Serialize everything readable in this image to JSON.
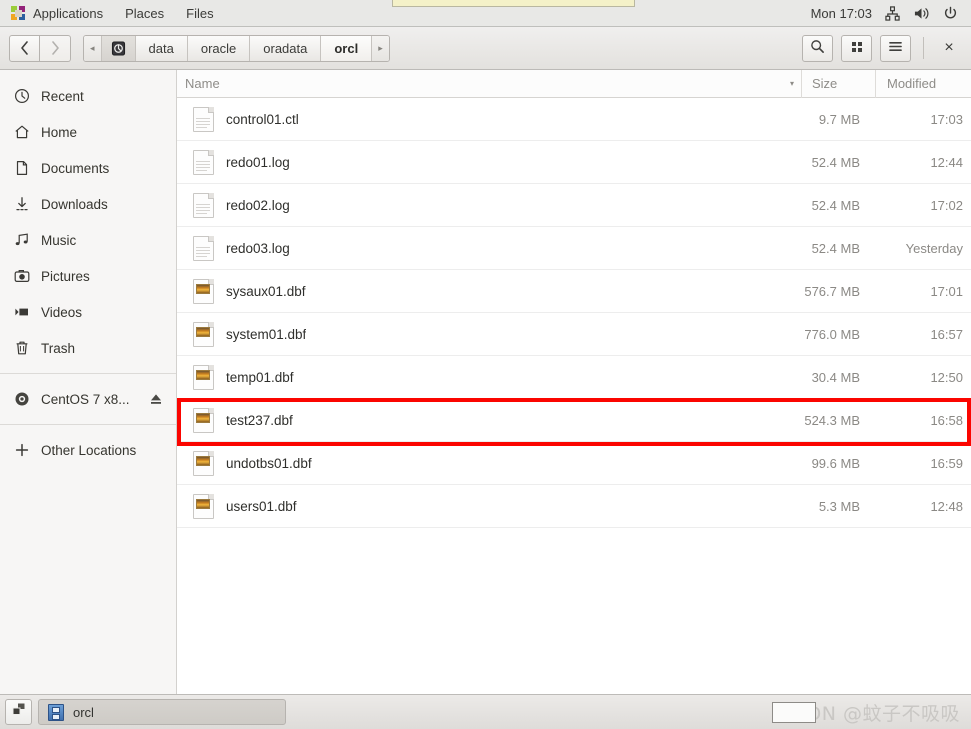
{
  "topbar": {
    "apps_label": "Applications",
    "places_label": "Places",
    "files_label": "Files",
    "clock": "Mon 17:03",
    "icons": [
      "network-icon",
      "volume-icon",
      "power-icon"
    ]
  },
  "window": {
    "title": "orcl",
    "nav": {
      "back_label": "‹",
      "forward_label": "›"
    },
    "pathbar": {
      "left_arrow": "◂",
      "right_arrow": "▸",
      "crumbs": [
        {
          "label": "data",
          "active": false
        },
        {
          "label": "oracle",
          "active": false
        },
        {
          "label": "oradata",
          "active": false
        },
        {
          "label": "orcl",
          "active": true
        }
      ]
    },
    "toolbar": {
      "search_label": "search-icon",
      "view_label": "grid-view-icon",
      "menu_label": "menu-icon",
      "close_label": "×"
    }
  },
  "sidebar": {
    "items": [
      {
        "label": "Recent",
        "icon": "clock-icon"
      },
      {
        "label": "Home",
        "icon": "home-icon"
      },
      {
        "label": "Documents",
        "icon": "document-icon"
      },
      {
        "label": "Downloads",
        "icon": "download-icon"
      },
      {
        "label": "Music",
        "icon": "music-icon"
      },
      {
        "label": "Pictures",
        "icon": "camera-icon"
      },
      {
        "label": "Videos",
        "icon": "video-icon"
      },
      {
        "label": "Trash",
        "icon": "trash-icon"
      }
    ],
    "devices": [
      {
        "label": "CentOS 7 x8...",
        "icon": "disc-icon",
        "eject": true
      }
    ],
    "other_locations": {
      "label": "Other Locations",
      "icon": "plus-icon"
    }
  },
  "filelist": {
    "columns": {
      "name": "Name",
      "size": "Size",
      "modified": "Modified"
    },
    "sort": {
      "column": "Name",
      "direction": "descending",
      "caret": "▾"
    },
    "rows": [
      {
        "name": "control01.ctl",
        "size": "9.7 MB",
        "modified": "17:03",
        "icon": "text-file-icon",
        "highlighted": false
      },
      {
        "name": "redo01.log",
        "size": "52.4 MB",
        "modified": "12:44",
        "icon": "text-file-icon",
        "highlighted": false
      },
      {
        "name": "redo02.log",
        "size": "52.4 MB",
        "modified": "17:02",
        "icon": "text-file-icon",
        "highlighted": false
      },
      {
        "name": "redo03.log",
        "size": "52.4 MB",
        "modified": "Yesterday",
        "icon": "text-file-icon",
        "highlighted": false
      },
      {
        "name": "sysaux01.dbf",
        "size": "576.7 MB",
        "modified": "17:01",
        "icon": "image-file-icon",
        "highlighted": false
      },
      {
        "name": "system01.dbf",
        "size": "776.0 MB",
        "modified": "16:57",
        "icon": "image-file-icon",
        "highlighted": false
      },
      {
        "name": "temp01.dbf",
        "size": "30.4 MB",
        "modified": "12:50",
        "icon": "image-file-icon",
        "highlighted": false
      },
      {
        "name": "test237.dbf",
        "size": "524.3 MB",
        "modified": "16:58",
        "icon": "image-file-icon",
        "highlighted": true
      },
      {
        "name": "undotbs01.dbf",
        "size": "99.6 MB",
        "modified": "16:59",
        "icon": "image-file-icon",
        "highlighted": false
      },
      {
        "name": "users01.dbf",
        "size": "5.3 MB",
        "modified": "12:48",
        "icon": "image-file-icon",
        "highlighted": false
      }
    ]
  },
  "taskbar": {
    "workspace_switcher": "workspace-switcher-icon",
    "tasks": [
      {
        "label": "orcl",
        "icon": "file-manager-icon"
      }
    ],
    "watermark": "CSDN @蚊子不吸吸"
  },
  "colors": {
    "annotation": "#fb0500",
    "topbar_bg": "#e8e8e6",
    "sidebar_bg": "#f7f6f5",
    "list_bg": "#ffffff"
  }
}
